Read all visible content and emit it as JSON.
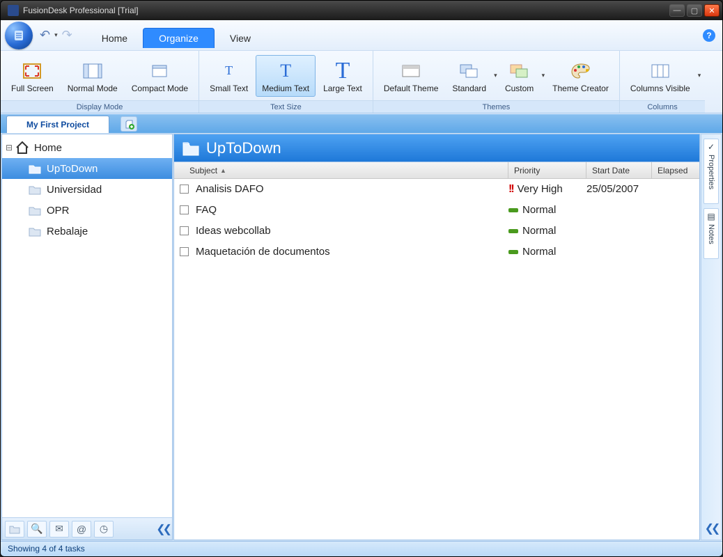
{
  "titlebar": {
    "title": "FusionDesk Professional [Trial]"
  },
  "ribbon": {
    "tabs": {
      "home": "Home",
      "organize": "Organize",
      "view": "View"
    },
    "groups": {
      "display": {
        "caption": "Display Mode",
        "full_screen": "Full Screen",
        "normal_mode": "Normal Mode",
        "compact_mode": "Compact Mode"
      },
      "text": {
        "caption": "Text Size",
        "small": "Small Text",
        "medium": "Medium Text",
        "large": "Large Text"
      },
      "themes": {
        "caption": "Themes",
        "default": "Default Theme",
        "standard": "Standard",
        "custom": "Custom",
        "creator": "Theme Creator"
      },
      "columns": {
        "caption": "Columns",
        "visible": "Columns Visible"
      }
    }
  },
  "project_tab": "My First Project",
  "tree": {
    "root": "Home",
    "items": [
      "UpToDown",
      "Universidad",
      "OPR",
      "Rebalaje"
    ],
    "selected_index": 0
  },
  "content": {
    "header": "UpToDown",
    "columns": {
      "subject": "Subject",
      "priority": "Priority",
      "start": "Start Date",
      "elapsed": "Elapsed"
    },
    "rows": [
      {
        "subject": "Analisis DAFO",
        "priority": "Very High",
        "priority_level": "very-high",
        "start": "25/05/2007",
        "elapsed": ""
      },
      {
        "subject": "FAQ",
        "priority": "Normal",
        "priority_level": "normal",
        "start": "",
        "elapsed": ""
      },
      {
        "subject": "Ideas webcollab",
        "priority": "Normal",
        "priority_level": "normal",
        "start": "",
        "elapsed": ""
      },
      {
        "subject": "Maquetación de documentos",
        "priority": "Normal",
        "priority_level": "normal",
        "start": "",
        "elapsed": ""
      }
    ]
  },
  "right_panes": {
    "properties": "Properties",
    "notes": "Notes"
  },
  "statusbar": "Showing 4 of 4 tasks"
}
